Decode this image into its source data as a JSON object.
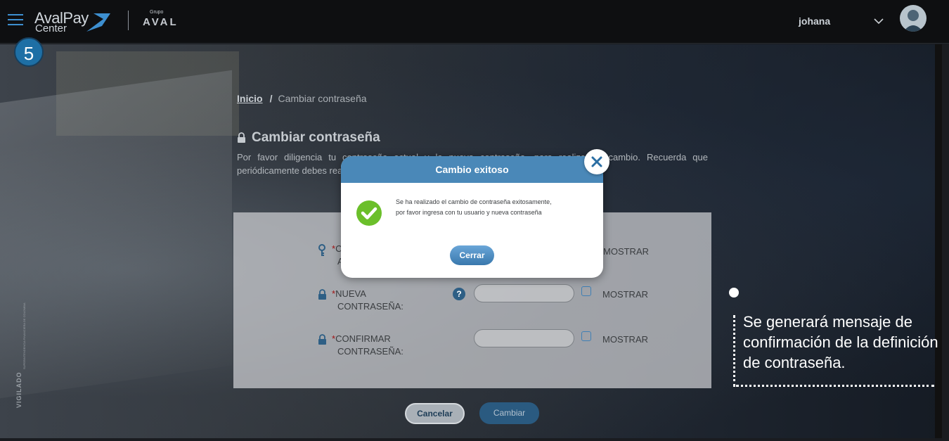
{
  "header": {
    "logo_line1": "AvalPay",
    "logo_line2": "Center",
    "grupo_small": "Grupo",
    "grupo_name": "AVAL",
    "username": "johana",
    "step_number": "5"
  },
  "breadcrumb": {
    "home": "Inicio",
    "separator": "/",
    "current": "Cambiar contraseña"
  },
  "page": {
    "title": "Cambiar contraseña",
    "intro": "Por favor diligencia tu contraseña actual y la nueva contraseña, para realizar el cambio. Recuerda que periódicamente debes realizar el cambio de tu contraseña."
  },
  "form": {
    "rows": [
      {
        "label_line1": "C",
        "label_line2": "A",
        "show": "MOSTRAR"
      },
      {
        "label_line1": "NUEVA",
        "label_line2": "CONTRASEÑA:",
        "show": "MOSTRAR",
        "help": "?"
      },
      {
        "label_line1": "CONFIRMAR",
        "label_line2": "CONTRASEÑA:",
        "show": "MOSTRAR"
      }
    ],
    "required_mark": "*",
    "cancel_label": "Cancelar",
    "submit_label": "Cambiar"
  },
  "vigilado": {
    "label": "VIGILADO",
    "small": "SUPERINTENDENCIA FINANCIERA DE COLOMBIA"
  },
  "modal": {
    "title": "Cambio exitoso",
    "message": "Se ha realizado el cambio de contraseña exitosamente, por favor ingresa con tu usuario y nueva contraseña",
    "close_label": "Cerrar"
  },
  "annotation": {
    "text": "Se generará mensaje de confirmación de la definición de contraseña."
  },
  "colors": {
    "accent": "#4a88b8",
    "success": "#6bbf2a",
    "required": "#a01313"
  }
}
